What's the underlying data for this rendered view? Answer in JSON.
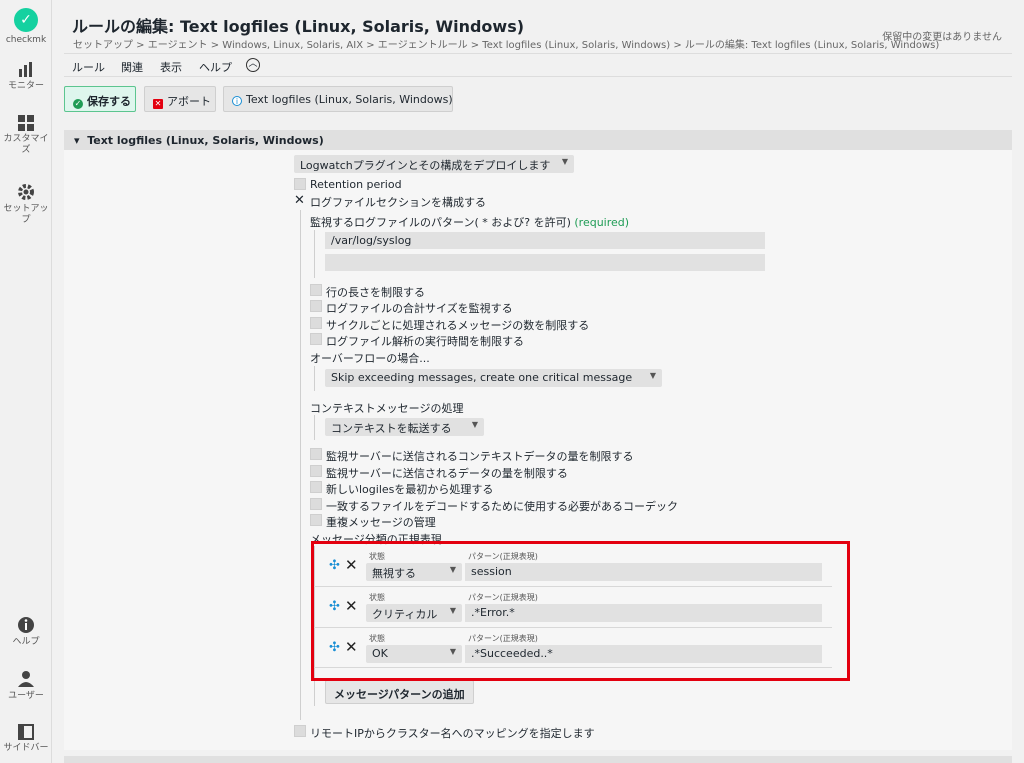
{
  "sidebar": {
    "logo": "checkmk",
    "items": [
      {
        "label": "モニター",
        "icon": "bar-chart-icon"
      },
      {
        "label": "カスタマイズ",
        "icon": "grid-icon"
      },
      {
        "label": "セットアップ",
        "icon": "gear-icon"
      },
      {
        "label": "ヘルプ",
        "icon": "info-icon"
      },
      {
        "label": "ユーザー",
        "icon": "user-icon"
      },
      {
        "label": "サイドバー",
        "icon": "sidebar-icon"
      }
    ]
  },
  "header": {
    "title": "ルールの編集: Text logfiles (Linux, Solaris, Windows)",
    "breadcrumb": "セットアップ > エージェント > Windows, Linux, Solaris, AIX > エージェントルール > Text logfiles (Linux, Solaris, Windows) > ルールの編集: Text logfiles (Linux, Solaris, Windows)",
    "pending": "保留中の変更はありません"
  },
  "menu": [
    "ルール",
    "関連",
    "表示",
    "ヘルプ"
  ],
  "buttons": {
    "save": "保存する",
    "abort": "アボート",
    "info": "Text logfiles (Linux, Solaris, Windows)"
  },
  "section": {
    "title": "Text logfiles (Linux, Solaris, Windows)",
    "deploy_select": "Logwatchプラグインとその構成をデプロイします",
    "retention": "Retention period",
    "configure_sections": "ログファイルセクションを構成する",
    "patterns_label": "監視するログファイルのパターン( * および? を許可)",
    "required": "(required)",
    "pattern_value": "/var/log/syslog",
    "pattern_empty": "",
    "limits": [
      "行の長さを制限する",
      "ログファイルの合計サイズを監視する",
      "サイクルごとに処理されるメッセージの数を制限する",
      "ログファイル解析の実行時間を制限する"
    ],
    "overflow_label": "オーバーフローの場合...",
    "overflow_value": "Skip exceeding messages, create one critical message",
    "context_label": "コンテキストメッセージの処理",
    "context_value": "コンテキストを転送する",
    "options": [
      "監視サーバーに送信されるコンテキストデータの量を制限する",
      "監視サーバーに送信されるデータの量を制限する",
      "新しいlogilesを最初から処理する",
      "一致するファイルをデコードするために使用する必要があるコーデック",
      "重複メッセージの管理"
    ],
    "classification_label": "メッセージ分類の正規表現",
    "rows": [
      {
        "state_label": "状態",
        "state": "無視する",
        "pattern_label": "パターン(正規表現)",
        "pattern": "session"
      },
      {
        "state_label": "状態",
        "state": "クリティカル",
        "pattern_label": "パターン(正規表現)",
        "pattern": ".*Error.*"
      },
      {
        "state_label": "状態",
        "state": "OK",
        "pattern_label": "パターン(正規表現)",
        "pattern": ".*Succeeded..*"
      }
    ],
    "add_pattern": "メッセージパターンの追加",
    "remote_ip": "リモートIPからクラスター名へのマッピングを指定します"
  },
  "colors": {
    "accent": "#15d1a0",
    "highlight": "#e3000f",
    "required": "#1f9c55"
  }
}
